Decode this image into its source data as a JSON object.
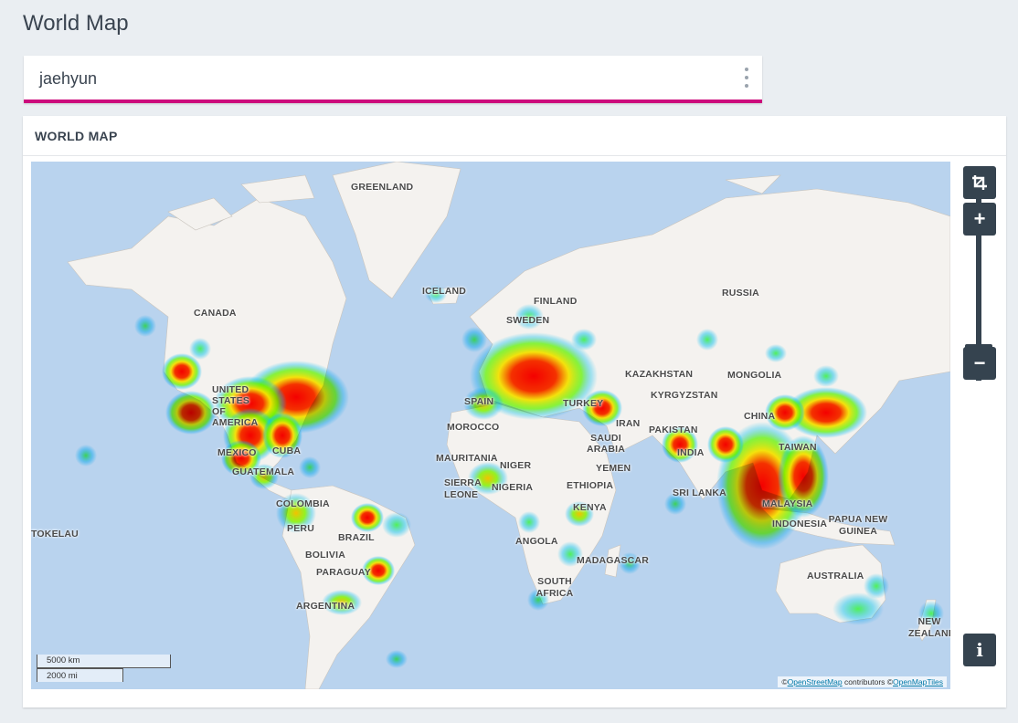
{
  "page": {
    "title": "World Map"
  },
  "selector": {
    "value": "jaehyun"
  },
  "panel": {
    "title": "WORLD MAP"
  },
  "map": {
    "labels": {
      "greenland": "GREENLAND",
      "iceland": "ICELAND",
      "finland": "FINLAND",
      "russia": "RUSSIA",
      "canada": "CANADA",
      "sweden": "SWEDEN",
      "kazakhstan": "KAZAKHSTAN",
      "mongolia": "MONGOLIA",
      "kyrgyzstan": "KYRGYZSTAN",
      "united_states": "UNITED STATES OF AMERICA",
      "spain": "SPAIN",
      "turkey": "TURKEY",
      "iran": "IRAN",
      "china": "CHINA",
      "morocco": "MOROCCO",
      "pakistan": "PAKISTAN",
      "saudi": "SAUDI ARABIA",
      "mexico": "MEXICO",
      "cuba": "CUBA",
      "india": "INDIA",
      "taiwan": "TAIWAN",
      "mauritania": "MAURITANIA",
      "niger": "NIGER",
      "yemen": "YEMEN",
      "guatemala": "GUATEMALA",
      "sierra_leone": "SIERRA LEONE",
      "nigeria": "NIGERIA",
      "ethiopia": "ETHIOPIA",
      "sri_lanka": "SRI LANKA",
      "malaysia": "MALAYSIA",
      "indonesia": "INDONESIA",
      "colombia": "COLOMBIA",
      "kenya": "KENYA",
      "papua": "PAPUA NEW GUINEA",
      "tokelau": "TOKELAU",
      "peru": "PERU",
      "brazil": "BRAZIL",
      "angola": "ANGOLA",
      "bolivia": "BOLIVIA",
      "madagascar": "MADAGASCAR",
      "paraguay": "PARAGUAY",
      "australia": "AUSTRALIA",
      "south_africa": "SOUTH AFRICA",
      "argentina": "ARGENTINA",
      "new_zealand": "NEW ZEALAND"
    },
    "scale_km": "5000 km",
    "scale_mi": "2000 mi",
    "attribution": {
      "prefix": "©",
      "osm": "OpenStreetMap",
      "mid": " contributors  ©",
      "omt": "OpenMapTiles"
    },
    "colors": {
      "ocean": "#b9d3ee",
      "land": "#f4f2ef",
      "heat_low": "#00c8ff",
      "heat_mid": "#66ff00",
      "heat_high": "#ffee00",
      "heat_max": "#ff0000"
    }
  },
  "controls": {
    "crop_icon": "crop-icon",
    "zoom_in": "+",
    "zoom_out": "−",
    "info": "i",
    "zoom_level": 0.33
  }
}
